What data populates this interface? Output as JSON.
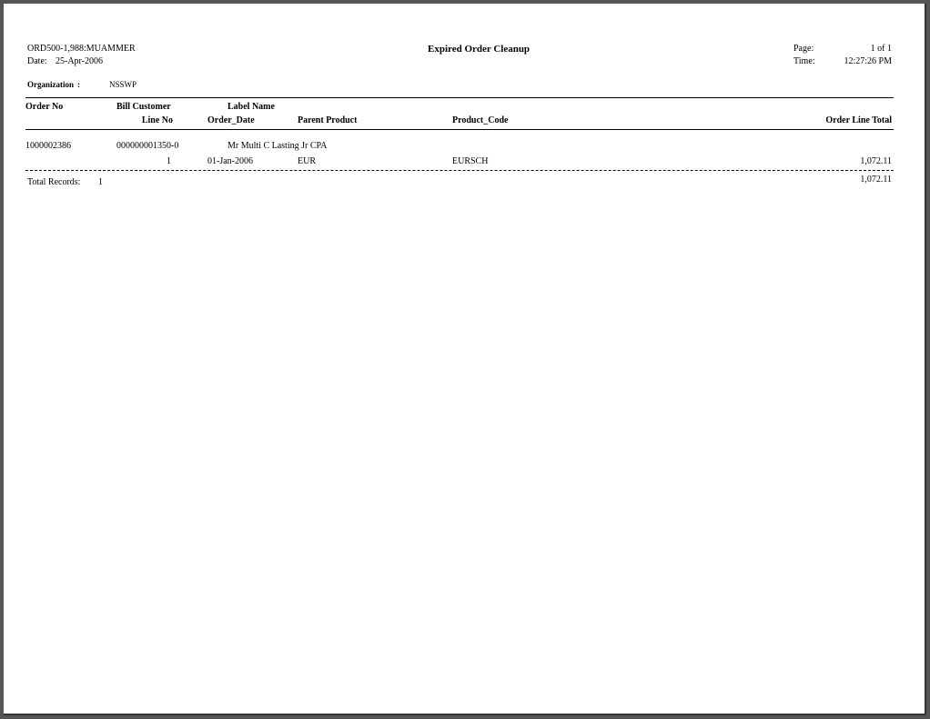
{
  "header": {
    "report_id": "ORD500-1,988:MUAMMER",
    "date_label": "Date:",
    "date_value": "25-Apr-2006",
    "title": "Expired Order Cleanup",
    "page_label": "Page:",
    "page_value": "1 of 1",
    "time_label": "Time:",
    "time_value": "12:27:26 PM",
    "org_label": "Organization",
    "org_sep": ":",
    "org_value": "NSSWP"
  },
  "columns": {
    "order_no": "Order No",
    "bill_customer": "Bill Customer",
    "label_name": "Label Name",
    "line_no": "Line No",
    "order_date": "Order_Date",
    "parent_product": "Parent Product",
    "product_code": "Product_Code",
    "order_line_total": "Order Line Total"
  },
  "orders": [
    {
      "order_no": "1000002386",
      "bill_customer": "000000001350-0",
      "label_name": "Mr Multi C Lasting Jr CPA",
      "line": {
        "line_no": "1",
        "order_date": "01-Jan-2006",
        "parent_product": "EUR",
        "product_code": "EURSCH",
        "order_line_total": "1,072.11"
      }
    }
  ],
  "footer": {
    "total_records_label": "Total Records:",
    "total_records_value": "1",
    "grand_total": "1,072.11"
  }
}
